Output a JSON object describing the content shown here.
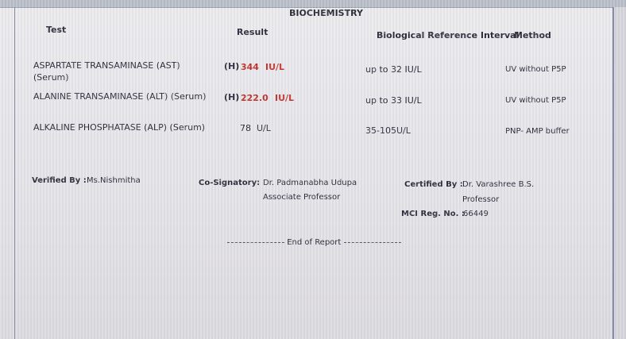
{
  "report": {
    "section_title": "BIOCHEMISTRY",
    "headers": {
      "test": "Test",
      "result": "Result",
      "reference": "Biological Reference Interval",
      "method": "Method"
    },
    "rows": [
      {
        "test": "ASPARTATE TRANSAMINASE (AST)",
        "specimen": "(Serum)",
        "flag": "(H)",
        "value": "344",
        "unit": "IU/L",
        "reference": "up to 32 IU/L",
        "method": "UV without P5P"
      },
      {
        "test": "ALANINE TRANSAMINASE (ALT) (Serum)",
        "flag": "(H)",
        "value": "222.0",
        "unit": "IU/L",
        "reference": "up to 33 IU/L",
        "method": "UV without P5P"
      },
      {
        "test": "ALKALINE PHOSPHATASE (ALP) (Serum)",
        "value": "78",
        "unit": "U/L",
        "reference": "35-105U/L",
        "method": "PNP- AMP buffer"
      }
    ],
    "signatures": {
      "verified_label": "Verified By :",
      "verified_name": "Ms.Nishmitha",
      "cosign_label": "Co-Signatory:",
      "cosign_name": "Dr. Padmanabha Udupa",
      "cosign_title": "Associate Professor",
      "certified_label": "Certified By :",
      "certified_name": "Dr. Varashree B.S.",
      "certified_title": "Professor",
      "mci_label": "MCI Reg. No. :",
      "mci_value": "66449"
    },
    "footer": "End of Report"
  },
  "colors": {
    "text": "#2a2a3a",
    "flag_red": "#c0302a",
    "background": "#e8e7eb"
  }
}
